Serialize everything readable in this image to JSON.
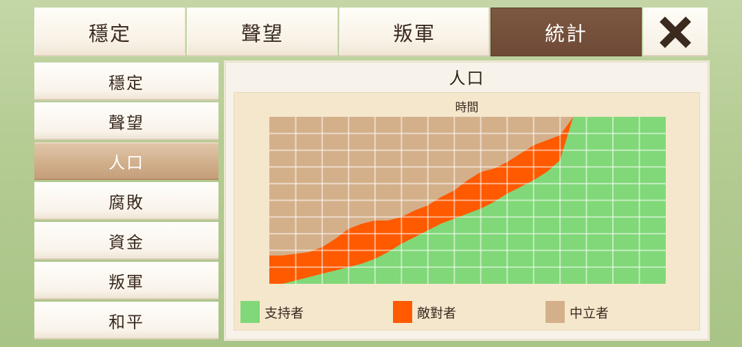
{
  "tabs": [
    {
      "label": "穩定",
      "active": false
    },
    {
      "label": "聲望",
      "active": false
    },
    {
      "label": "叛軍",
      "active": false
    },
    {
      "label": "統計",
      "active": true
    }
  ],
  "close_icon": "close-x-icon",
  "sidebar": {
    "items": [
      {
        "label": "穩定",
        "active": false
      },
      {
        "label": "聲望",
        "active": false
      },
      {
        "label": "人口",
        "active": true
      },
      {
        "label": "腐敗",
        "active": false
      },
      {
        "label": "資金",
        "active": false
      },
      {
        "label": "叛軍",
        "active": false
      },
      {
        "label": "和平",
        "active": false
      }
    ]
  },
  "panel": {
    "title": "人口"
  },
  "chart_data": {
    "type": "area",
    "stacked": true,
    "normalized": true,
    "xlabel": "時間",
    "ylabel": "",
    "ylim": [
      0,
      100
    ],
    "grid": true,
    "legend_position": "bottom",
    "x": [
      0,
      1,
      2,
      3,
      4,
      5,
      6,
      7,
      8,
      9,
      10,
      11,
      12,
      13,
      14,
      15,
      16,
      17,
      18,
      19,
      20,
      21,
      22,
      23,
      24,
      25,
      26,
      27,
      28,
      29,
      30
    ],
    "series": [
      {
        "name": "支持者",
        "color": "#80d878",
        "values": [
          0,
          0,
          2,
          4,
          6,
          8,
          10,
          12,
          15,
          19,
          24,
          28,
          32,
          36,
          39,
          42,
          45,
          49,
          54,
          58,
          62,
          67,
          74,
          100,
          100,
          100,
          100,
          100,
          100,
          100,
          100
        ]
      },
      {
        "name": "敵對者",
        "color": "#ff5a00",
        "values": [
          17,
          17,
          16,
          15,
          16,
          19,
          23,
          24,
          23,
          19,
          16,
          16,
          15,
          16,
          17,
          20,
          22,
          20,
          19,
          20,
          21,
          19,
          15,
          0,
          0,
          0,
          0,
          0,
          0,
          0,
          0
        ]
      },
      {
        "name": "中立者",
        "color": "#d4b08a",
        "values": [
          83,
          83,
          82,
          81,
          78,
          73,
          67,
          64,
          62,
          62,
          60,
          56,
          53,
          48,
          44,
          38,
          33,
          31,
          27,
          22,
          17,
          14,
          11,
          0,
          0,
          0,
          0,
          0,
          0,
          0,
          0
        ]
      }
    ]
  }
}
